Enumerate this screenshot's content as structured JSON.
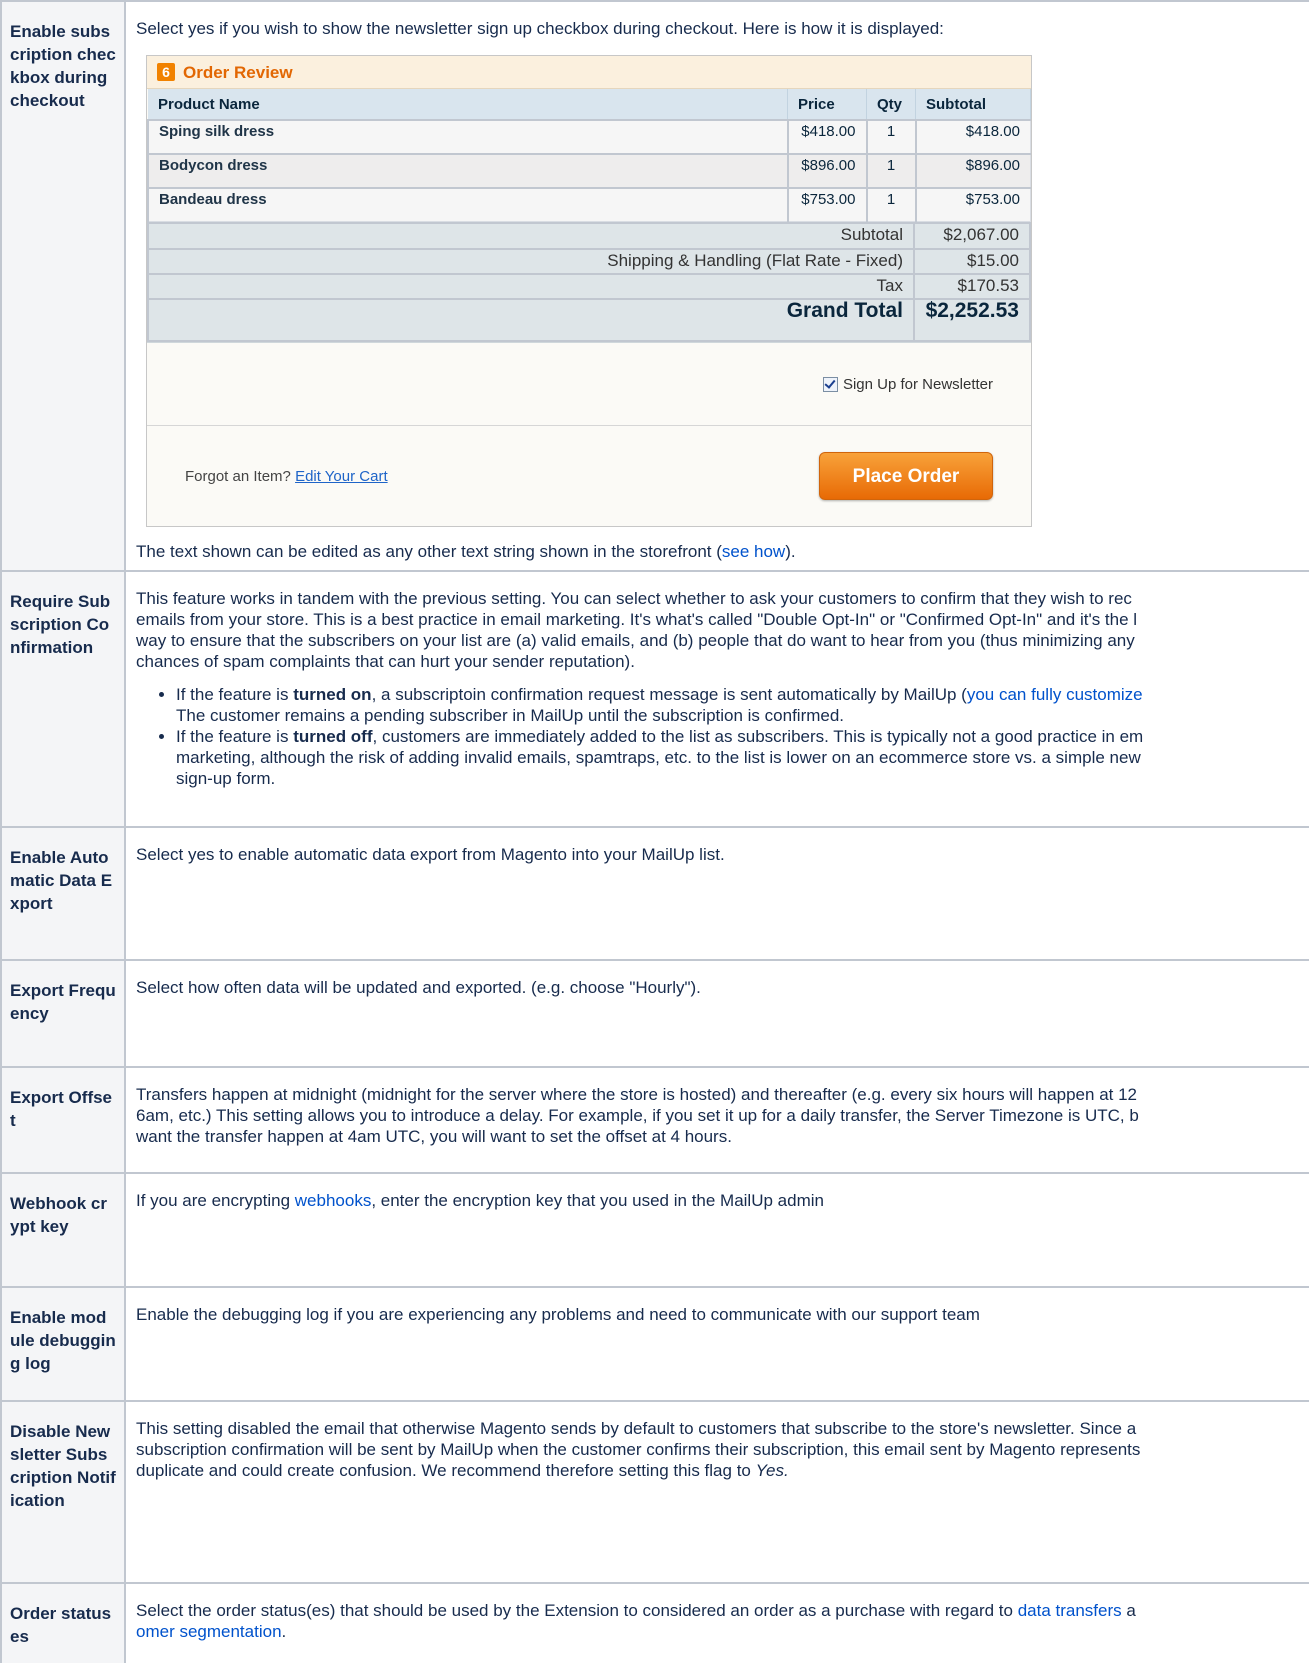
{
  "rows": {
    "r1": {
      "key": "Enable subscription checkbox during checkout",
      "intro": "Select yes if you wish to show the newsletter sign up checkbox during checkout. Here is how it is displayed:",
      "after_pre": "The text shown can be edited as any other text string shown in the storefront (",
      "after_link": "see how",
      "after_post": ")."
    },
    "r2": {
      "key": "Require Subscription Confirmation",
      "lines": [
        "This feature works in tandem with the previous setting. You can select whether to ask your customers to confirm that they wish to rec",
        "emails from your store. This is a best practice in email marketing. It's what's called \"Double Opt-In\" or \"Confirmed Opt-In\" and it's the l",
        "way to ensure that the subscribers on your list are (a) valid emails, and (b) people that do want to hear from you (thus minimizing any",
        "chances of spam complaints that can hurt your sender reputation)."
      ],
      "b1_pre": "If the feature is ",
      "b1_bold": "turned on",
      "b1_mid": ", a subscriptoin confirmation request message is sent automatically by MailUp (",
      "b1_link": "you can fully customize",
      "b1_line2": "The customer remains a pending subscriber in MailUp until the subscription is confirmed.",
      "b2_pre": "If the feature is ",
      "b2_bold": "turned off",
      "b2_mid": ", customers are immediately added to the list as subscribers. This is typically not a good practice in em",
      "b2_line2": "marketing, although the risk of adding invalid emails, spamtraps, etc. to the list is lower on an ecommerce store vs. a simple new",
      "b2_line3": "sign-up form."
    },
    "r3": {
      "key": "Enable Automatic Data Export",
      "text": "Select yes to enable automatic data export from Magento into your MailUp list."
    },
    "r4": {
      "key": "Export Frequency",
      "text": "Select how often data will be updated and exported. (e.g. choose \"Hourly\")."
    },
    "r5": {
      "key": "Export Offset",
      "lines": [
        "Transfers happen at midnight (midnight for the server where the store is hosted) and thereafter (e.g. every six hours will happen at 12",
        "6am, etc.) This setting allows you to introduce a delay. For example, if you set it up for a daily transfer, the Server Timezone is UTC, b",
        "want the transfer happen at 4am UTC, you will want to set the offset at 4 hours."
      ]
    },
    "r6": {
      "key": "Webhook crypt key",
      "pre": "If you are encrypting ",
      "link": "webhooks",
      "post": ", enter the encryption key that you used in the MailUp admin"
    },
    "r7": {
      "key": "Enable module debugging log",
      "text": "Enable the debugging log if you are experiencing any problems and need to communicate with our support team"
    },
    "r8": {
      "key": "Disable Newsletter Subscription Notification",
      "lines": [
        "This setting disabled the email that otherwise Magento sends by default to customers that subscribe to the store's newsletter. Since a",
        "subscription confirmation will be sent by MailUp when the customer confirms their subscription, this email sent by Magento represents",
        "duplicate and could create confusion. We recommend therefore setting this flag to "
      ],
      "italic": "Yes."
    },
    "r9": {
      "key": "Order statuses",
      "pre": "Select the order status(es) that should be used by the Extension to considered an order as a purchase with regard to ",
      "link1": "data transfers",
      "mid": " a",
      "link2": "omer segmentation",
      "post": "."
    }
  },
  "checkout": {
    "step_number": "6",
    "title": "Order Review",
    "headers": {
      "name": "Product Name",
      "price": "Price",
      "qty": "Qty",
      "subtotal": "Subtotal"
    },
    "items": [
      {
        "name": "Sping silk dress",
        "price": "$418.00",
        "qty": "1",
        "subtotal": "$418.00"
      },
      {
        "name": "Bodycon dress",
        "price": "$896.00",
        "qty": "1",
        "subtotal": "$896.00"
      },
      {
        "name": "Bandeau dress",
        "price": "$753.00",
        "qty": "1",
        "subtotal": "$753.00"
      }
    ],
    "totals": [
      {
        "label": "Subtotal",
        "value": "$2,067.00"
      },
      {
        "label": "Shipping & Handling (Flat Rate - Fixed)",
        "value": "$15.00"
      },
      {
        "label": "Tax",
        "value": "$170.53"
      }
    ],
    "grand_total_label": "Grand Total",
    "grand_total_value": "$2,252.53",
    "newsletter_label": "Sign Up for Newsletter",
    "forgot_text": "Forgot an Item?",
    "edit_cart_link": "Edit Your Cart",
    "place_order_button": "Place Order"
  }
}
